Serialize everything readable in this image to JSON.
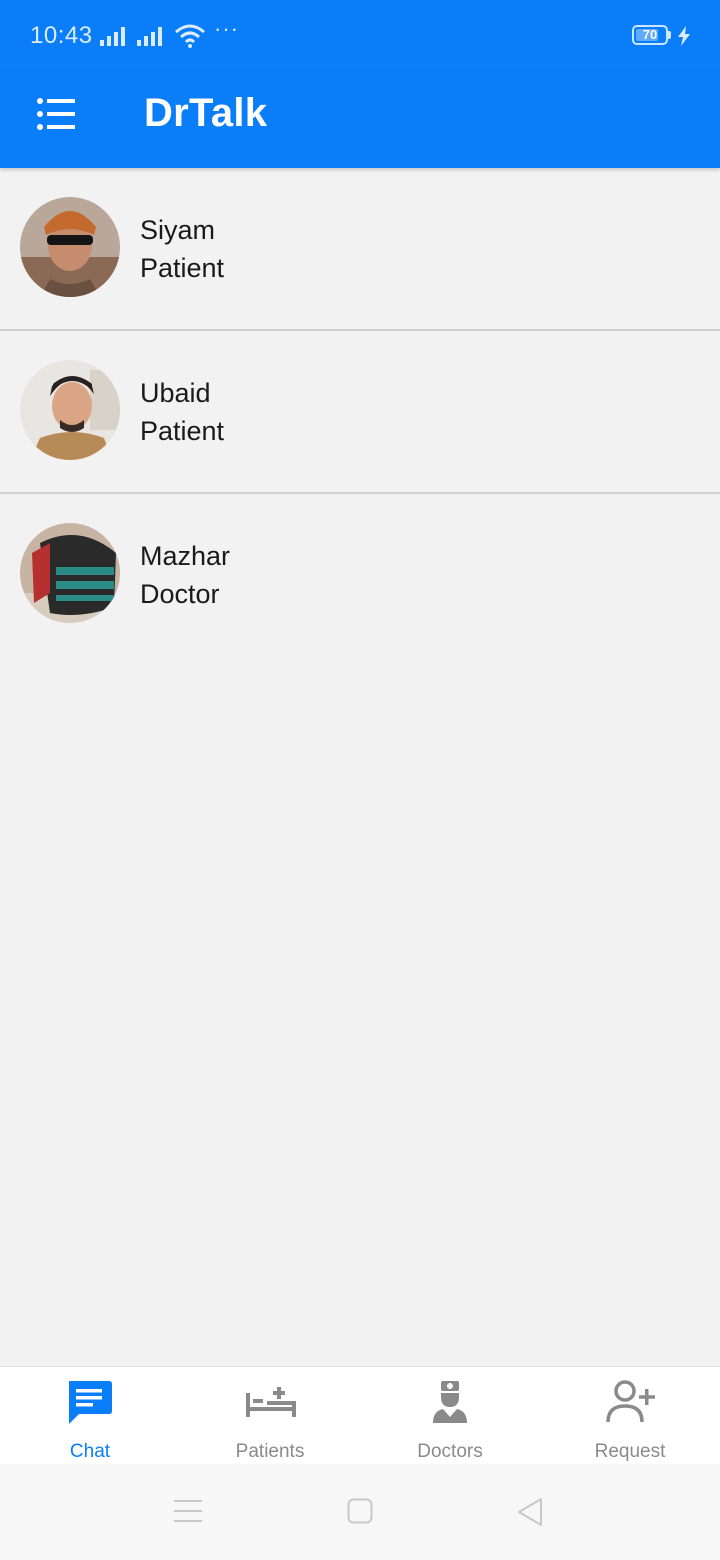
{
  "status_bar": {
    "time": "10:43",
    "battery_level": "70",
    "overflow": "···"
  },
  "app_bar": {
    "title": "DrTalk",
    "menu_icon": "menu-list-icon"
  },
  "contacts": [
    {
      "name": "Siyam",
      "role": "Patient",
      "avatar": "avatar-photo"
    },
    {
      "name": "Ubaid",
      "role": "Patient",
      "avatar": "avatar-photo"
    },
    {
      "name": "Mazhar",
      "role": "Doctor",
      "avatar": "avatar-photo"
    }
  ],
  "bottom_nav": [
    {
      "label": "Chat",
      "icon": "chat-icon",
      "active": true
    },
    {
      "label": "Patients",
      "icon": "hospital-bed-icon",
      "active": false
    },
    {
      "label": "Doctors",
      "icon": "doctor-icon",
      "active": false
    },
    {
      "label": "Request",
      "icon": "add-person-icon",
      "active": false
    }
  ],
  "colors": {
    "primary": "#0a7ef8",
    "background": "#f2f2f2",
    "inactive": "#8a8a8a"
  }
}
